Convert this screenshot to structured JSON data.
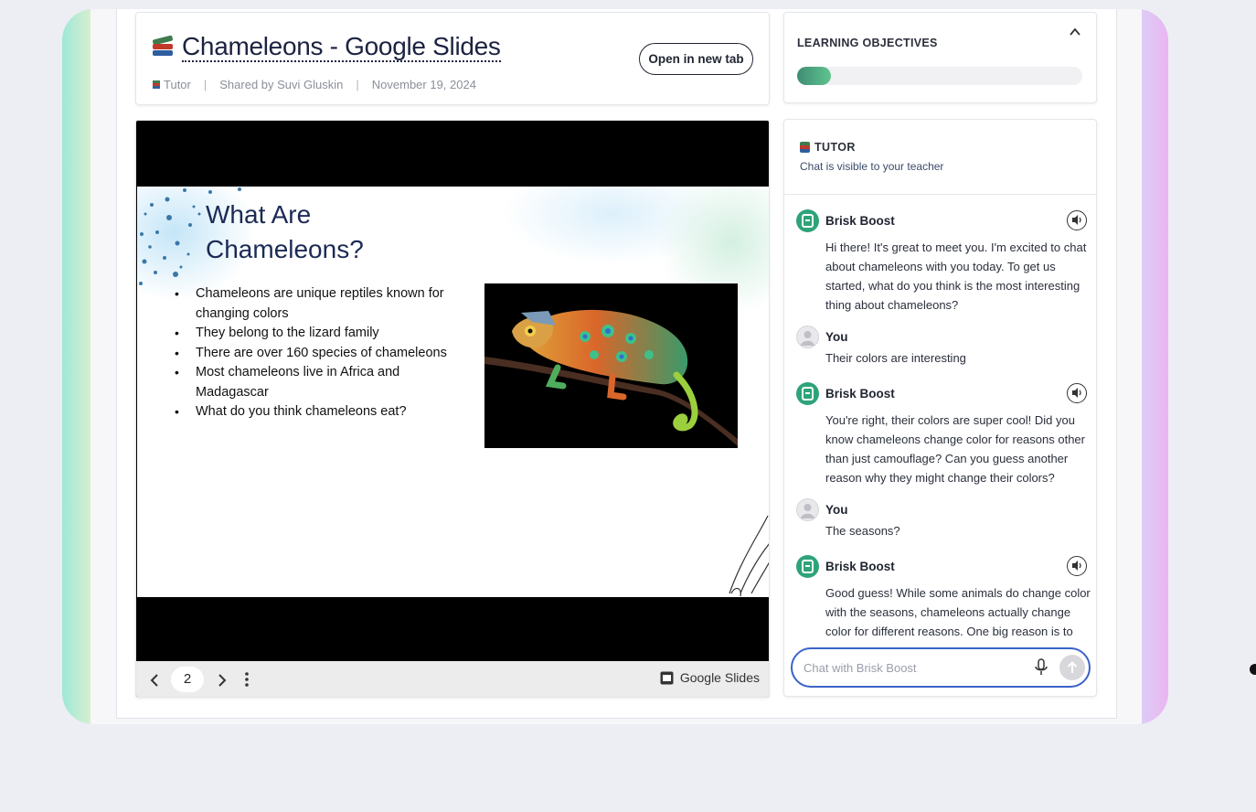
{
  "header": {
    "title": "Chameleons - Google Slides",
    "tutor_label": "Tutor",
    "shared_by": "Shared by Suvi Gluskin",
    "date": "November 19, 2024",
    "open_button": "Open in new tab"
  },
  "slide": {
    "heading_line1": "What Are",
    "heading_line2": "Chameleons?",
    "bullets": [
      "Chameleons are unique reptiles known for changing colors",
      "They belong to the lizard family",
      "There are over 160 species of chameleons",
      "Most chameleons live in Africa and Madagascar",
      "What do you think chameleons eat?"
    ],
    "page_number": "2",
    "app_label": "Google Slides"
  },
  "objectives": {
    "label": "LEARNING OBJECTIVES",
    "progress": 0.12
  },
  "chat": {
    "title": "TUTOR",
    "visibility_note": "Chat is visible to your teacher",
    "messages": [
      {
        "sender": "Brisk Boost",
        "text": "Hi there! It's great to meet you. I'm excited to chat about chameleons with you today. To get us started, what do you think is the most interesting thing about chameleons?"
      },
      {
        "sender": "You",
        "text": "Their colors are interesting"
      },
      {
        "sender": "Brisk Boost",
        "text": "You're right, their colors are super cool! Did you know chameleons change color for reasons other than just camouflage? Can you guess another reason why they might change their colors?"
      },
      {
        "sender": "You",
        "text": "The seasons?"
      },
      {
        "sender": "Brisk Boost",
        "text": "Good guess! While some animals do change color with the seasons, chameleons actually change color for different reasons. One big reason is to"
      }
    ],
    "input_placeholder": "Chat with Brisk Boost"
  },
  "colors": {
    "accent": "#3b63c8",
    "bot_avatar": "#2ea37a",
    "progress_fill": "#4fa67f"
  }
}
